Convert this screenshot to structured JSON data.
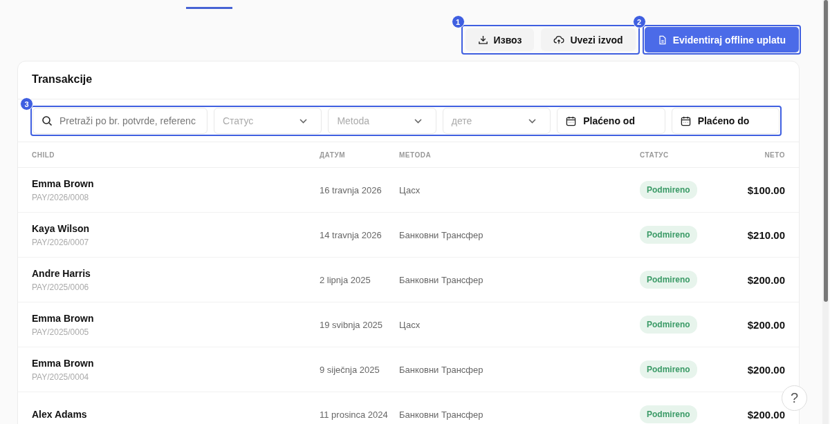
{
  "tabs_indicator": {
    "selected": true
  },
  "actions": [
    {
      "kind": "export",
      "label": "Извоз"
    },
    {
      "kind": "import",
      "label": "Uvezi izvod"
    }
  ],
  "primary_action": {
    "label": "Evidentiraj offline uplatu"
  },
  "annotations": [
    "1",
    "2",
    "3"
  ],
  "card": {
    "title": "Transakcije"
  },
  "filters": {
    "search": {
      "placeholder": "Pretraži po br. potvrde, referenc"
    },
    "selects": [
      {
        "placeholder": "Статус"
      },
      {
        "placeholder": "Metoda"
      },
      {
        "placeholder": "дете"
      }
    ],
    "dates": [
      {
        "label": "Plaćeno od"
      },
      {
        "label": "Plaćeno do"
      }
    ]
  },
  "table": {
    "columns": [
      "CHILD",
      "ДАТУМ",
      "METODA",
      "СТАТУС",
      "NETO"
    ],
    "rows": [
      {
        "name": "Emma Brown",
        "ref": "PAY/2026/0008",
        "date": "16 travnja 2026",
        "method": "Цасх",
        "status": "Podmireno",
        "net": "$100.00"
      },
      {
        "name": "Kaya Wilson",
        "ref": "PAY/2026/0007",
        "date": "14 travnja 2026",
        "method": "Банковни Трансфер",
        "status": "Podmireno",
        "net": "$210.00"
      },
      {
        "name": "Andre Harris",
        "ref": "PAY/2025/0006",
        "date": "2 lipnja 2025",
        "method": "Банковни Трансфер",
        "status": "Podmireno",
        "net": "$200.00"
      },
      {
        "name": "Emma Brown",
        "ref": "PAY/2025/0005",
        "date": "19 svibnja 2025",
        "method": "Цасх",
        "status": "Podmireno",
        "net": "$200.00"
      },
      {
        "name": "Emma Brown",
        "ref": "PAY/2025/0004",
        "date": "9 siječnja 2025",
        "method": "Банковни Трансфер",
        "status": "Podmireno",
        "net": "$200.00"
      },
      {
        "name": "Alex Adams",
        "date": "11 prosinca 2024",
        "method": "Банковни Трансфер",
        "status": "Podmireno",
        "net": "$200.00"
      }
    ]
  },
  "help": {
    "label": "?"
  }
}
